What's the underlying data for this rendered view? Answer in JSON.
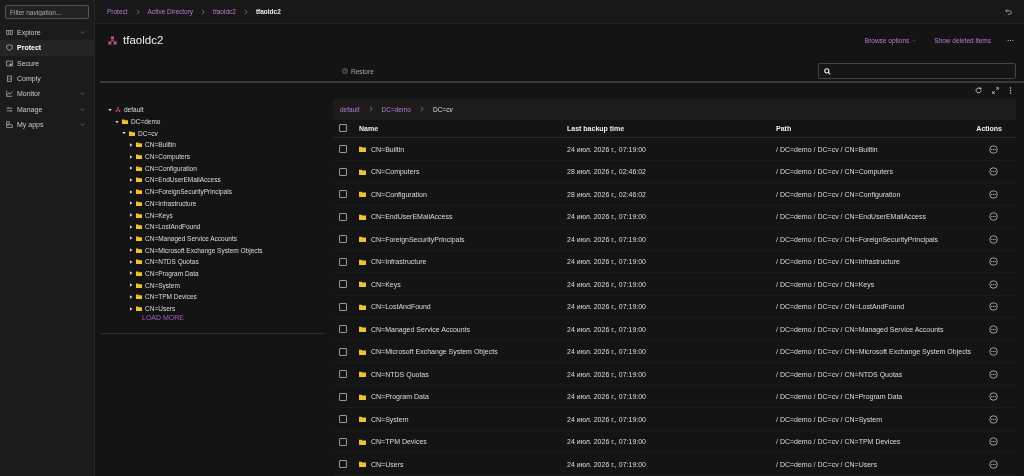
{
  "sidebar": {
    "filter": {
      "placeholder": "Filter navigation..."
    },
    "items": [
      {
        "label": "Explore",
        "expandable": true,
        "selected": false
      },
      {
        "label": "Protect",
        "expandable": false,
        "selected": true
      },
      {
        "label": "Secure",
        "expandable": false,
        "selected": false
      },
      {
        "label": "Comply",
        "expandable": false,
        "selected": false
      },
      {
        "label": "Monitor",
        "expandable": true,
        "selected": false
      },
      {
        "label": "Manage",
        "expandable": true,
        "selected": false
      },
      {
        "label": "My apps",
        "expandable": true,
        "selected": false
      }
    ]
  },
  "breadcrumb": [
    "Protect",
    "Active Directory",
    "tfaoldc2",
    "tfaoldc2"
  ],
  "title": "tfaoldc2",
  "header_actions": {
    "browse": "Browse options",
    "show_deleted": "Show deleted items"
  },
  "toolbar": {
    "restore": "Restore"
  },
  "tree": [
    {
      "label": "default",
      "kind": "domain",
      "expanded": true,
      "children": [
        {
          "label": "DC=demo",
          "kind": "folder",
          "expanded": true,
          "children": [
            {
              "label": "DC=cv",
              "kind": "folder",
              "expanded": true,
              "children": [
                {
                  "label": "CN=Builtin",
                  "kind": "folder",
                  "expanded": false
                },
                {
                  "label": "CN=Computers",
                  "kind": "folder",
                  "expanded": false
                },
                {
                  "label": "CN=Configuration",
                  "kind": "folder",
                  "expanded": false
                },
                {
                  "label": "CN=EndUserEMailAccess",
                  "kind": "folder",
                  "expanded": false
                },
                {
                  "label": "CN=ForeignSecurityPrincipals",
                  "kind": "folder",
                  "expanded": false
                },
                {
                  "label": "CN=Infrastructure",
                  "kind": "folder",
                  "expanded": false
                },
                {
                  "label": "CN=Keys",
                  "kind": "folder",
                  "expanded": false
                },
                {
                  "label": "CN=LostAndFound",
                  "kind": "folder",
                  "expanded": false
                },
                {
                  "label": "CN=Managed Service Accounts",
                  "kind": "folder",
                  "expanded": false
                },
                {
                  "label": "CN=Microsoft Exchange System Objects",
                  "kind": "folder",
                  "expanded": false
                },
                {
                  "label": "CN=NTDS Quotas",
                  "kind": "folder",
                  "expanded": false
                },
                {
                  "label": "CN=Program Data",
                  "kind": "folder",
                  "expanded": false
                },
                {
                  "label": "CN=System",
                  "kind": "folder",
                  "expanded": false
                },
                {
                  "label": "CN=TPM Devices",
                  "kind": "folder",
                  "expanded": false
                },
                {
                  "label": "CN=Users",
                  "kind": "folder",
                  "expanded": false
                }
              ]
            }
          ]
        }
      ]
    }
  ],
  "tree_load_more": "LOAD MORE",
  "path_crumbs": [
    "default",
    "DC=demo",
    "DC=cv"
  ],
  "table": {
    "all_checked": false,
    "columns": [
      "Name",
      "Last backup time",
      "Path",
      "Actions"
    ],
    "rows": [
      {
        "checked": false,
        "name": "CN=Builtin",
        "time": "24 июл. 2026 г., 07:19:00",
        "path": "/ DC=demo / DC=cv / CN=Builtin"
      },
      {
        "checked": false,
        "name": "CN=Computers",
        "time": "28 июл. 2026 г., 02:46:02",
        "path": "/ DC=demo / DC=cv / CN=Computers"
      },
      {
        "checked": false,
        "name": "CN=Configuration",
        "time": "28 июл. 2026 г., 02:46:02",
        "path": "/ DC=demo / DC=cv / CN=Configuration"
      },
      {
        "checked": false,
        "name": "CN=EndUserEMailAccess",
        "time": "24 июл. 2026 г., 07:19:00",
        "path": "/ DC=demo / DC=cv / CN=EndUserEMailAccess"
      },
      {
        "checked": false,
        "name": "CN=ForeignSecurityPrincipals",
        "time": "24 июл. 2026 г., 07:19:00",
        "path": "/ DC=demo / DC=cv / CN=ForeignSecurityPrincipals"
      },
      {
        "checked": false,
        "name": "CN=Infrastructure",
        "time": "24 июл. 2026 г., 07:19:00",
        "path": "/ DC=demo / DC=cv / CN=Infrastructure"
      },
      {
        "checked": false,
        "name": "CN=Keys",
        "time": "24 июл. 2026 г., 07:19:00",
        "path": "/ DC=demo / DC=cv / CN=Keys"
      },
      {
        "checked": false,
        "name": "CN=LostAndFound",
        "time": "24 июл. 2026 г., 07:19:00",
        "path": "/ DC=demo / DC=cv / CN=LostAndFound"
      },
      {
        "checked": false,
        "name": "CN=Managed Service Accounts",
        "time": "24 июл. 2026 г., 07:19:00",
        "path": "/ DC=demo / DC=cv / CN=Managed Service Accounts"
      },
      {
        "checked": false,
        "name": "CN=Microsoft Exchange System Objects",
        "time": "24 июл. 2026 г., 07:19:00",
        "path": "/ DC=demo / DC=cv / CN=Microsoft Exchange System Objects"
      },
      {
        "checked": false,
        "name": "CN=NTDS Quotas",
        "time": "24 июл. 2026 г., 07:19:00",
        "path": "/ DC=demo / DC=cv / CN=NTDS Quotas"
      },
      {
        "checked": false,
        "name": "CN=Program Data",
        "time": "24 июл. 2026 г., 07:19:00",
        "path": "/ DC=demo / DC=cv / CN=Program Data"
      },
      {
        "checked": false,
        "name": "CN=System",
        "time": "24 июл. 2026 г., 07:19:00",
        "path": "/ DC=demo / DC=cv / CN=System"
      },
      {
        "checked": false,
        "name": "CN=TPM Devices",
        "time": "24 июл. 2026 г., 07:19:00",
        "path": "/ DC=demo / DC=cv / CN=TPM Devices"
      },
      {
        "checked": false,
        "name": "CN=Users",
        "time": "24 июл. 2026 г., 07:19:00",
        "path": "/ DC=demo / DC=cv / CN=Users"
      }
    ]
  }
}
